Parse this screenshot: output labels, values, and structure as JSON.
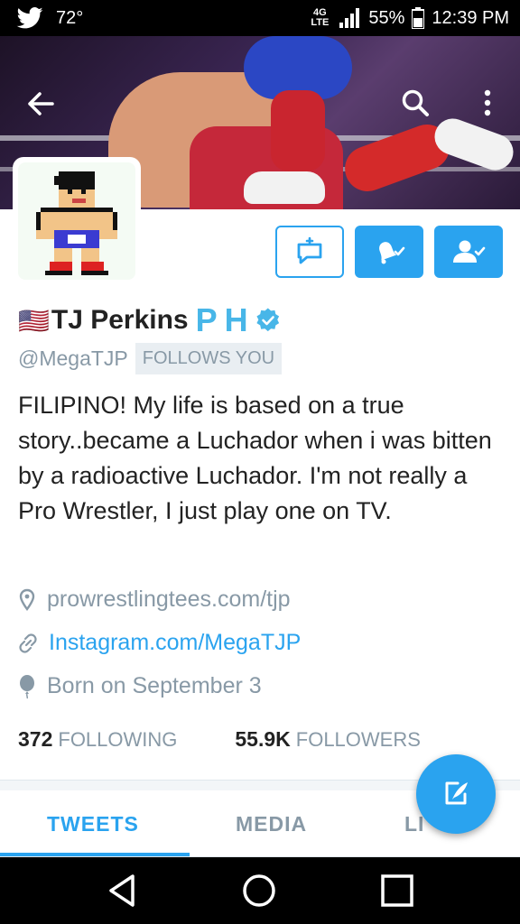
{
  "status_bar": {
    "temperature": "72°",
    "network": "4G LTE",
    "battery": "55%",
    "time": "12:39 PM"
  },
  "profile": {
    "flag": "🇺🇸",
    "name": "TJ Perkins",
    "name_badge": "PH",
    "handle": "@MegaTJP",
    "follows_you": "FOLLOWS YOU",
    "bio": "FILIPINO! My life is based on a true story..became a Luchador when i was bitten by a radioactive Luchador. I'm not really a Pro Wrestler, I just play one on TV.",
    "location": "prowrestlingtees.com/tjp",
    "website": "Instagram.com/MegaTJP",
    "birthday": "Born on September 3",
    "following_count": "372",
    "following_label": "FOLLOWING",
    "followers_count": "55.9K",
    "followers_label": "FOLLOWERS"
  },
  "tabs": [
    {
      "label": "TWEETS",
      "active": true
    },
    {
      "label": "MEDIA",
      "active": false
    },
    {
      "label": "LI",
      "active": false
    }
  ],
  "icons": {
    "back": "arrow-left-icon",
    "search": "search-icon",
    "more": "more-vertical-icon",
    "dm": "direct-message-icon",
    "notifications": "bell-check-icon",
    "following": "user-check-icon",
    "verified": "verified-badge-icon",
    "compose": "compose-tweet-icon"
  },
  "colors": {
    "accent": "#2aa3ef",
    "muted": "#8899a6",
    "text": "#222222"
  }
}
